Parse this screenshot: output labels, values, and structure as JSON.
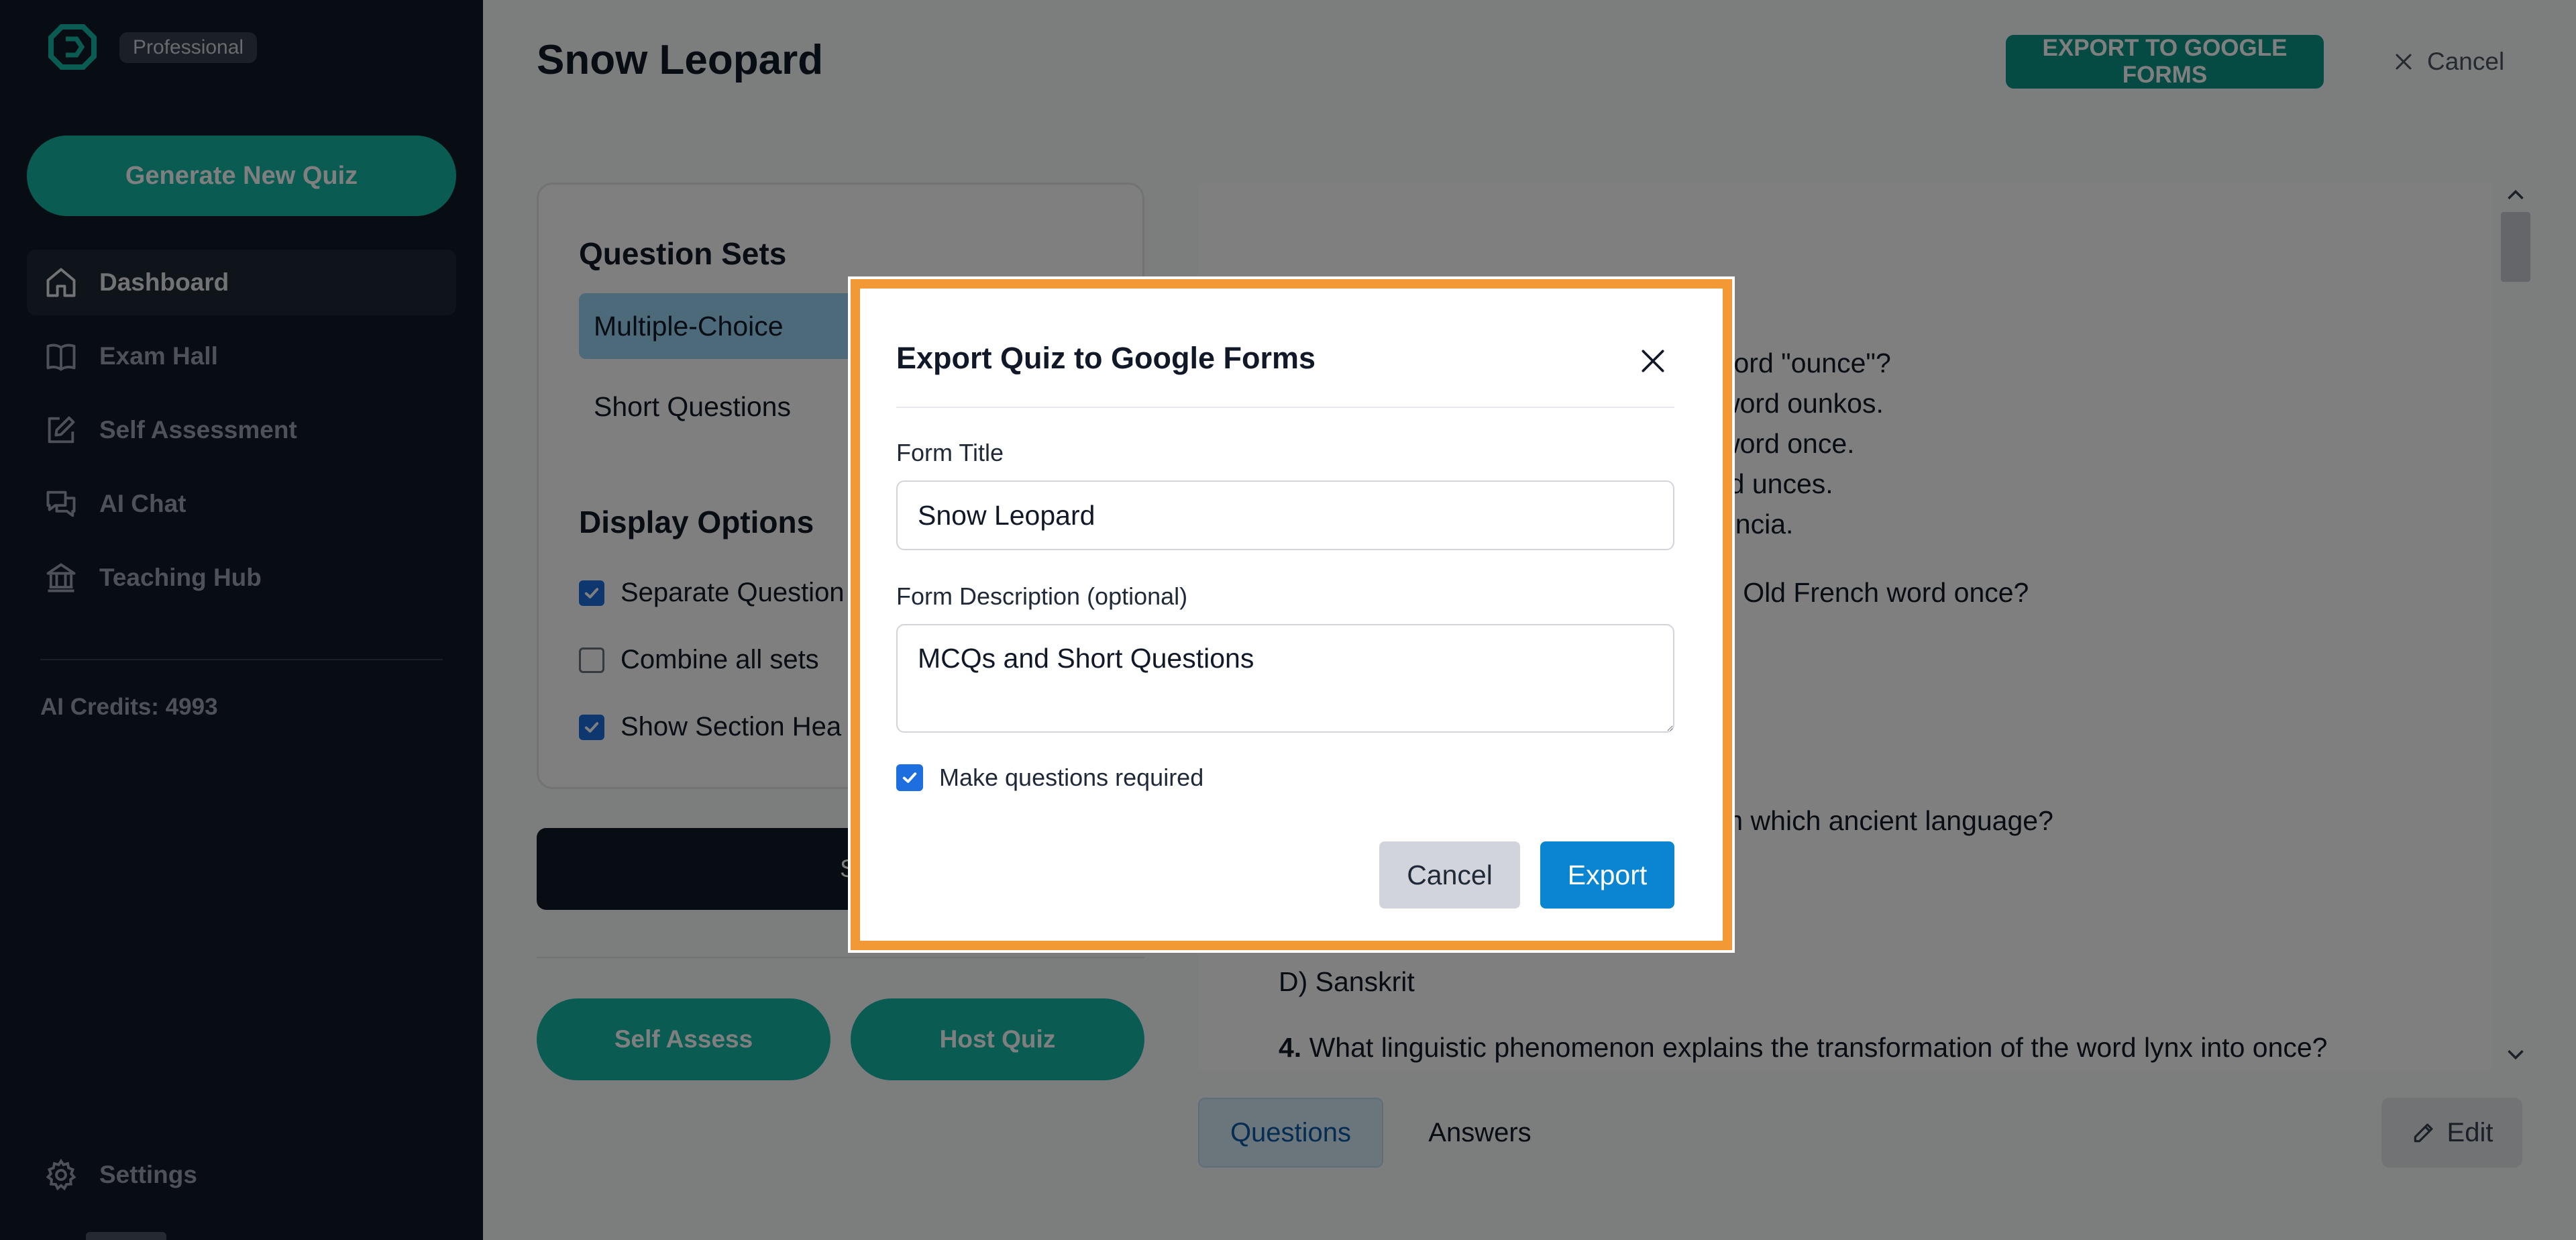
{
  "sidebar": {
    "logo_icon": "app-logo-icon",
    "tier": "Professional",
    "generate_label": "Generate New Quiz",
    "nav": [
      {
        "label": "Dashboard",
        "icon": "home-icon"
      },
      {
        "label": "Exam Hall",
        "icon": "book-icon"
      },
      {
        "label": "Self Assessment",
        "icon": "edit-square-icon"
      },
      {
        "label": "AI Chat",
        "icon": "chat-icon"
      },
      {
        "label": "Teaching Hub",
        "icon": "bank-icon"
      }
    ],
    "credits": "AI Credits: 4993",
    "settings_label": "Settings"
  },
  "header": {
    "title": "Snow Leopard",
    "export_label": "EXPORT TO GOOGLE FORMS",
    "cancel_label": "Cancel"
  },
  "settings_panel": {
    "question_sets_heading": "Question Sets",
    "sets": [
      "Multiple-Choice",
      "Short Questions"
    ],
    "display_heading": "Display Options",
    "options": [
      {
        "label": "Separate Question",
        "checked": true
      },
      {
        "label": "Combine all sets",
        "checked": false
      },
      {
        "label": "Show Section Hea",
        "checked": true
      }
    ],
    "save_label": "Save Changes",
    "self_assess_label": "Self Assess",
    "host_quiz_label": "Host Quiz"
  },
  "content": {
    "lines": [
      "vord \"ounce\"?",
      "word ounkos.",
      "word once.",
      "rd unces.",
      "uncia.",
      "e Old French word once?",
      "m which ancient language?",
      "D)  Sanskrit"
    ],
    "q4_number": "4.",
    "q4_text": "What linguistic phenomenon explains the transformation of the word lynx into once?",
    "tab_questions": "Questions",
    "tab_answers": "Answers",
    "edit_label": "Edit"
  },
  "modal": {
    "title": "Export Quiz to Google Forms",
    "form_title_label": "Form Title",
    "form_title_value": "Snow Leopard",
    "description_label": "Form Description (optional)",
    "description_value": "MCQs and Short Questions",
    "required_label": "Make questions required",
    "required_checked": true,
    "cancel_label": "Cancel",
    "export_label": "Export"
  },
  "colors": {
    "sidebar_bg": "#111827",
    "teal": "#14b8a6",
    "highlight_orange": "#f29935",
    "export_blue": "#0a85d1"
  }
}
